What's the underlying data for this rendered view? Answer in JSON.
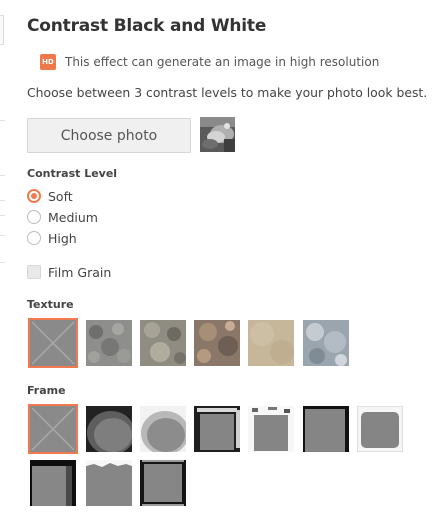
{
  "title": "Contrast Black and White",
  "hd": {
    "badge": "HD",
    "text": "This effect can generate an image in high resolution"
  },
  "description": "Choose between 3 contrast levels to make your photo look best.",
  "choose_button_label": "Choose photo",
  "contrast": {
    "label": "Contrast Level",
    "options": [
      {
        "label": "Soft",
        "selected": true
      },
      {
        "label": "Medium",
        "selected": false
      },
      {
        "label": "High",
        "selected": false
      }
    ]
  },
  "film_grain": {
    "label": "Film Grain",
    "checked": false
  },
  "texture": {
    "label": "Texture",
    "items": [
      "none",
      "gray-stone",
      "mossy-stone",
      "rust",
      "tan-paper",
      "blue-clouds"
    ],
    "selected_index": 0
  },
  "frame": {
    "label": "Frame",
    "items": [
      "none",
      "dark-vignette",
      "light-vignette",
      "grunge-dark",
      "grunge-white",
      "black-border",
      "rounded-light",
      "black-fade",
      "torn-paper",
      "film-strip"
    ],
    "selected_index": 0
  },
  "colors": {
    "accent": "#ef7a4f",
    "hd_badge": "#f0774a",
    "placeholder_gray": "#8a8a8a"
  }
}
